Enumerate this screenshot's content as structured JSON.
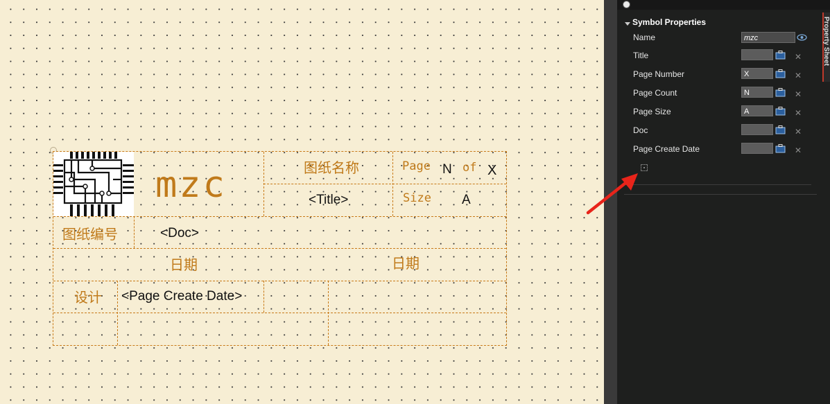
{
  "title_block": {
    "company": "mzc",
    "drawing_name_label": "图纸名称",
    "page_label": "Page",
    "page_number": "N",
    "of_label": "of",
    "page_count": "X",
    "title_field": "<Title>",
    "size_label": "Size",
    "size_value": "A",
    "drawing_number_label": "图纸编号",
    "doc_field": "<Doc>",
    "date_label_1": "日期",
    "date_label_2": "日期",
    "design_label": "设计",
    "date_field": "<Page Create Date>"
  },
  "panel": {
    "header": "Symbol Properties",
    "side_tab": "Property Sheet",
    "properties": [
      {
        "label": "Name",
        "value": "mzc"
      },
      {
        "label": "Title",
        "value": ""
      },
      {
        "label": "Page Number",
        "value": "X"
      },
      {
        "label": "Page Count",
        "value": "N"
      },
      {
        "label": "Page Size",
        "value": "A"
      },
      {
        "label": "Doc",
        "value": ""
      },
      {
        "label": "Page Create Date",
        "value": ""
      }
    ]
  },
  "icons": {
    "pin": "pin-icon",
    "eye": "eye-icon",
    "clipboard": "clipboard-icon",
    "remove": "close-icon",
    "add": "add-field-icon",
    "arrow": "red-arrow"
  },
  "colors": {
    "canvas_bg": "#f7eed4",
    "title_block_line": "#c87a18",
    "title_block_text": "#c07a1a",
    "panel_bg": "#1e1f1e",
    "arrow": "#e8241a"
  }
}
